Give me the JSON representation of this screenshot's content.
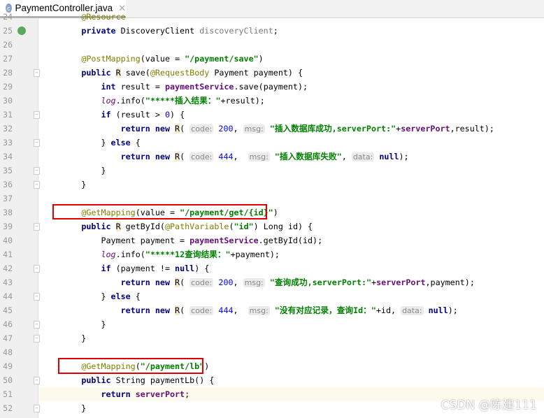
{
  "tab": {
    "title": "PaymentController.java",
    "icon": "class-c-icon",
    "icon_letter": "c"
  },
  "watermark": "CSDN @陈建111",
  "current_line": 51,
  "lines": [
    {
      "n": 24,
      "tokens": [
        [
          "    ",
          ""
        ],
        [
          "@Resource",
          "ann"
        ]
      ]
    },
    {
      "n": 25,
      "gutter_icon": "spring-bean-icon",
      "tokens": [
        [
          "    ",
          ""
        ],
        [
          "private ",
          "kw"
        ],
        [
          "DiscoveryClient ",
          ""
        ],
        [
          "discoveryClient",
          "fldg"
        ],
        [
          ";",
          ""
        ]
      ]
    },
    {
      "n": 26,
      "tokens": []
    },
    {
      "n": 27,
      "tokens": [
        [
          "    ",
          ""
        ],
        [
          "@PostMapping",
          "ann"
        ],
        [
          "(value = ",
          ""
        ],
        [
          "\"/payment/save\"",
          "str"
        ],
        [
          ")",
          ""
        ]
      ]
    },
    {
      "n": 28,
      "fold": true,
      "tokens": [
        [
          "    ",
          ""
        ],
        [
          "public ",
          "kw"
        ],
        [
          "R",
          "rh"
        ],
        [
          " save(",
          ""
        ],
        [
          "@RequestBody",
          "ann"
        ],
        [
          " Payment payment) {",
          ""
        ]
      ]
    },
    {
      "n": 29,
      "tokens": [
        [
          "        ",
          ""
        ],
        [
          "int ",
          "kw"
        ],
        [
          "result = ",
          ""
        ],
        [
          "paymentService",
          "fld"
        ],
        [
          ".save(payment);",
          ""
        ]
      ]
    },
    {
      "n": 30,
      "tokens": [
        [
          "        ",
          ""
        ],
        [
          "log",
          "log"
        ],
        [
          ".info(",
          ""
        ],
        [
          "\"*****插入结果：\"",
          "str"
        ],
        [
          "+result);",
          ""
        ]
      ]
    },
    {
      "n": 31,
      "fold": true,
      "tokens": [
        [
          "        ",
          ""
        ],
        [
          "if ",
          "kw"
        ],
        [
          "(result > ",
          ""
        ],
        [
          "0",
          "num"
        ],
        [
          ") {",
          ""
        ]
      ]
    },
    {
      "n": 32,
      "tokens": [
        [
          "            ",
          ""
        ],
        [
          "return new ",
          "kw"
        ],
        [
          "R",
          "rh"
        ],
        [
          "( ",
          ""
        ],
        [
          "code:",
          "hint"
        ],
        [
          " ",
          ""
        ],
        [
          "200",
          "num"
        ],
        [
          ", ",
          ""
        ],
        [
          "msg:",
          "hint"
        ],
        [
          " ",
          ""
        ],
        [
          "\"插入数据库成功,serverPort:\"",
          "str"
        ],
        [
          "+",
          ""
        ],
        [
          "serverPort",
          "fld"
        ],
        [
          ",result);",
          ""
        ]
      ]
    },
    {
      "n": 33,
      "fold": true,
      "tokens": [
        [
          "        ",
          ""
        ],
        [
          "} ",
          ""
        ],
        [
          "else ",
          "kw"
        ],
        [
          "{",
          ""
        ]
      ]
    },
    {
      "n": 34,
      "tokens": [
        [
          "            ",
          ""
        ],
        [
          "return new ",
          "kw"
        ],
        [
          "R",
          "rh"
        ],
        [
          "( ",
          ""
        ],
        [
          "code:",
          "hint"
        ],
        [
          " ",
          ""
        ],
        [
          "444",
          "num"
        ],
        [
          ",  ",
          ""
        ],
        [
          "msg:",
          "hint"
        ],
        [
          " ",
          ""
        ],
        [
          "\"插入数据库失败\"",
          "str"
        ],
        [
          ", ",
          ""
        ],
        [
          "data:",
          "hint"
        ],
        [
          " ",
          ""
        ],
        [
          "null",
          "kw"
        ],
        [
          ");",
          ""
        ]
      ]
    },
    {
      "n": 35,
      "fold": true,
      "tokens": [
        [
          "        }",
          ""
        ]
      ]
    },
    {
      "n": 36,
      "fold": true,
      "tokens": [
        [
          "    }",
          ""
        ]
      ]
    },
    {
      "n": 37,
      "tokens": []
    },
    {
      "n": 38,
      "tokens": [
        [
          "    ",
          ""
        ],
        [
          "@GetMapping",
          "ann"
        ],
        [
          "(value = ",
          ""
        ],
        [
          "\"/payment/get/{id}\"",
          "str"
        ],
        [
          ")",
          ""
        ]
      ]
    },
    {
      "n": 39,
      "fold": true,
      "tokens": [
        [
          "    ",
          ""
        ],
        [
          "public ",
          "kw"
        ],
        [
          "R",
          "rh"
        ],
        [
          " getById(",
          ""
        ],
        [
          "@PathVariable",
          "ann"
        ],
        [
          "(",
          ""
        ],
        [
          "\"id\"",
          "str"
        ],
        [
          ") Long id) {",
          ""
        ]
      ]
    },
    {
      "n": 40,
      "tokens": [
        [
          "        Payment payment = ",
          ""
        ],
        [
          "paymentService",
          "fld"
        ],
        [
          ".getById(id);",
          ""
        ]
      ]
    },
    {
      "n": 41,
      "tokens": [
        [
          "        ",
          ""
        ],
        [
          "log",
          "log"
        ],
        [
          ".info(",
          ""
        ],
        [
          "\"*****12查询结果：\"",
          "str"
        ],
        [
          "+payment);",
          ""
        ]
      ]
    },
    {
      "n": 42,
      "fold": true,
      "tokens": [
        [
          "        ",
          ""
        ],
        [
          "if ",
          "kw"
        ],
        [
          "(payment != ",
          ""
        ],
        [
          "null",
          "kw"
        ],
        [
          ") {",
          ""
        ]
      ]
    },
    {
      "n": 43,
      "tokens": [
        [
          "            ",
          ""
        ],
        [
          "return new ",
          "kw"
        ],
        [
          "R",
          "rh"
        ],
        [
          "( ",
          ""
        ],
        [
          "code:",
          "hint"
        ],
        [
          " ",
          ""
        ],
        [
          "200",
          "num"
        ],
        [
          ", ",
          ""
        ],
        [
          "msg:",
          "hint"
        ],
        [
          " ",
          ""
        ],
        [
          "\"查询成功,serverPort:\"",
          "str"
        ],
        [
          "+",
          ""
        ],
        [
          "serverPort",
          "fld"
        ],
        [
          ",payment);",
          ""
        ]
      ]
    },
    {
      "n": 44,
      "fold": true,
      "tokens": [
        [
          "        ",
          ""
        ],
        [
          "} ",
          ""
        ],
        [
          "else ",
          "kw"
        ],
        [
          "{",
          ""
        ]
      ]
    },
    {
      "n": 45,
      "tokens": [
        [
          "            ",
          ""
        ],
        [
          "return new ",
          "kw"
        ],
        [
          "R",
          "rh"
        ],
        [
          "( ",
          ""
        ],
        [
          "code:",
          "hint"
        ],
        [
          " ",
          ""
        ],
        [
          "444",
          "num"
        ],
        [
          ",  ",
          ""
        ],
        [
          "msg:",
          "hint"
        ],
        [
          " ",
          ""
        ],
        [
          "\"没有对应记录，查询Id：\"",
          "str"
        ],
        [
          "+id, ",
          ""
        ],
        [
          "data:",
          "hint"
        ],
        [
          " ",
          ""
        ],
        [
          "null",
          "kw"
        ],
        [
          ");",
          ""
        ]
      ]
    },
    {
      "n": 46,
      "fold": true,
      "tokens": [
        [
          "        }",
          ""
        ]
      ]
    },
    {
      "n": 47,
      "fold": true,
      "tokens": [
        [
          "    }",
          ""
        ]
      ]
    },
    {
      "n": 48,
      "tokens": []
    },
    {
      "n": 49,
      "tokens": [
        [
          "    ",
          ""
        ],
        [
          "@GetMapping",
          "ann"
        ],
        [
          "(",
          ""
        ],
        [
          "\"/payment/lb\"",
          "str"
        ],
        [
          ")",
          ""
        ]
      ]
    },
    {
      "n": 50,
      "fold": true,
      "tokens": [
        [
          "    ",
          ""
        ],
        [
          "public ",
          "kw"
        ],
        [
          "String paymentLb() {",
          ""
        ]
      ]
    },
    {
      "n": 51,
      "tokens": [
        [
          "        ",
          ""
        ],
        [
          "return ",
          "kw"
        ],
        [
          "serverPort",
          "fld"
        ],
        [
          ";",
          ""
        ]
      ]
    },
    {
      "n": 52,
      "fold": true,
      "tokens": [
        [
          "    }",
          ""
        ]
      ]
    }
  ],
  "colors": {
    "highlight_box": "#e00000",
    "keyword": "#000080",
    "string": "#008000",
    "annotation": "#808000",
    "number": "#0000ff",
    "field": "#660e7a"
  }
}
